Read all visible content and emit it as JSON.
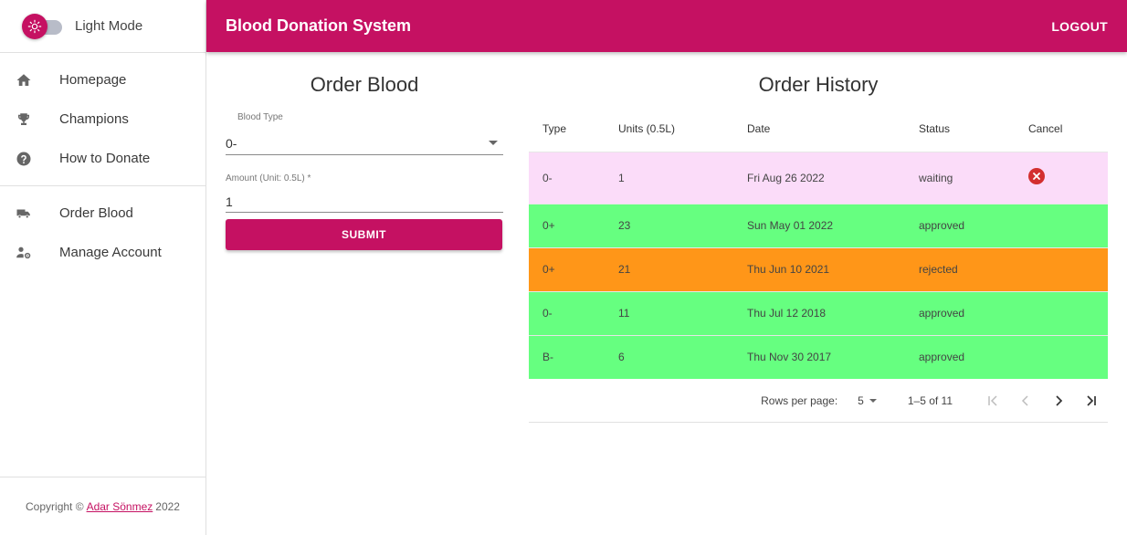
{
  "mode": {
    "label": "Light Mode"
  },
  "nav": {
    "primary": [
      {
        "label": "Homepage",
        "icon": "home-icon"
      },
      {
        "label": "Champions",
        "icon": "trophy-icon"
      },
      {
        "label": "How to Donate",
        "icon": "help-icon"
      }
    ],
    "secondary": [
      {
        "label": "Order Blood",
        "icon": "truck-icon"
      },
      {
        "label": "Manage Account",
        "icon": "user-gear-icon"
      }
    ]
  },
  "footer": {
    "prefix": "Copyright ©",
    "author": "Adar Sönmez",
    "year": "2022"
  },
  "header": {
    "title": "Blood Donation System",
    "logout_label": "LOGOUT"
  },
  "order_form": {
    "title": "Order Blood",
    "blood_type_label": "Blood Type",
    "blood_type_value": "0-",
    "amount_label": "Amount (Unit: 0.5L) *",
    "amount_value": "1",
    "submit_label": "SUBMIT"
  },
  "history": {
    "title": "Order History",
    "columns": [
      "Type",
      "Units (0.5L)",
      "Date",
      "Status",
      "Cancel"
    ],
    "rows": [
      {
        "type": "0-",
        "units": "1",
        "date": "Fri Aug 26 2022",
        "status": "waiting"
      },
      {
        "type": "0+",
        "units": "23",
        "date": "Sun May 01 2022",
        "status": "approved"
      },
      {
        "type": "0+",
        "units": "21",
        "date": "Thu Jun 10 2021",
        "status": "rejected"
      },
      {
        "type": "0-",
        "units": "11",
        "date": "Thu Jul 12 2018",
        "status": "approved"
      },
      {
        "type": "B-",
        "units": "6",
        "date": "Thu Nov 30 2017",
        "status": "approved"
      }
    ],
    "status_colors": {
      "waiting": "#fbdcf9",
      "approved": "#66ff80",
      "rejected": "#ff9618"
    },
    "pagination": {
      "rows_per_page_label": "Rows per page:",
      "rows_per_page_value": "5",
      "range_label": "1–5 of 11"
    }
  },
  "colors": {
    "brand": "#c51162"
  }
}
